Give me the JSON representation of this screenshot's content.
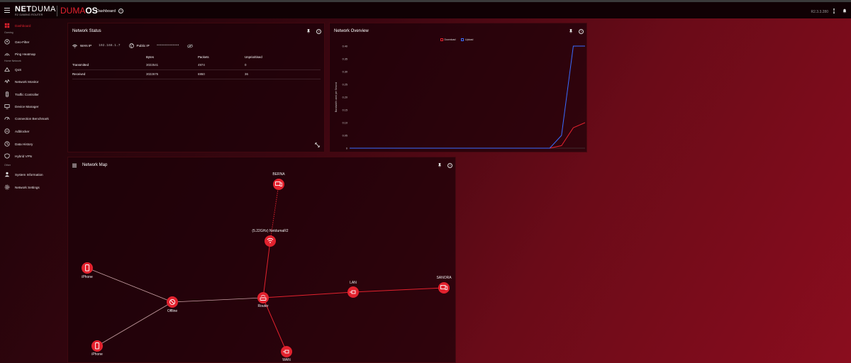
{
  "topbar": {
    "logo_net": "NET",
    "logo_duma": "DUMA",
    "logo_sub": "R2 GAMING ROUTER",
    "logo_os_duma": "DUMA",
    "logo_os": "OS",
    "breadcrumb": "Dashboard",
    "version": "R2.3.3.280"
  },
  "sidebar": {
    "items": [
      {
        "label": "Dashboard",
        "icon": "dashboard-icon",
        "active": true
      },
      {
        "section": "Gaming"
      },
      {
        "label": "Geo-Filter",
        "icon": "geo-filter-icon"
      },
      {
        "label": "Ping Heatmap",
        "icon": "ping-heatmap-icon"
      },
      {
        "section": "Home Network"
      },
      {
        "label": "QoS",
        "icon": "qos-icon"
      },
      {
        "label": "Network Monitor",
        "icon": "network-monitor-icon"
      },
      {
        "label": "Traffic Controller",
        "icon": "traffic-controller-icon"
      },
      {
        "label": "Device Manager",
        "icon": "device-manager-icon"
      },
      {
        "label": "Connection Benchmark",
        "icon": "benchmark-icon"
      },
      {
        "label": "Adblocker",
        "icon": "adblocker-icon"
      },
      {
        "label": "Data History",
        "icon": "data-history-icon"
      },
      {
        "label": "Hybrid VPN",
        "icon": "vpn-icon"
      },
      {
        "section": "Other"
      },
      {
        "label": "System Information",
        "icon": "system-info-icon"
      },
      {
        "label": "Network Settings",
        "icon": "settings-icon"
      }
    ]
  },
  "network_status": {
    "title": "Network Status",
    "wan_ip_label": "WAN IP",
    "wan_ip_value": "192.168.1.7",
    "public_ip_label": "Public IP",
    "public_ip_value": "••••••••••••••",
    "columns": [
      "",
      "Bytes",
      "Packets",
      "Unprioritised"
    ],
    "rows": [
      [
        "Transmitted",
        "3022541",
        "4974",
        "0"
      ],
      [
        "Received",
        "3022675",
        "6950",
        "36"
      ]
    ]
  },
  "network_overview": {
    "title": "Network Overview",
    "legend": [
      {
        "name": "Download",
        "color": "#e2222e"
      },
      {
        "name": "Upload",
        "color": "#3a6bff"
      }
    ],
    "ylabel": "Bandwidth used per Second"
  },
  "chart_data": {
    "type": "line",
    "ylabel": "Bandwidth used per Second",
    "ylim": [
      0,
      0.4
    ],
    "yticks": [
      "0",
      "0.05",
      "0.10",
      "0.15",
      "0.20",
      "0.25",
      "0.30",
      "0.35",
      "0.40"
    ],
    "x": [
      0,
      1,
      2,
      3,
      4,
      5,
      6,
      7,
      8,
      9,
      10,
      11,
      12,
      13,
      14,
      15,
      16,
      17,
      18,
      19,
      20
    ],
    "series": [
      {
        "name": "Download",
        "color": "#e2222e",
        "values": [
          0,
          0,
          0,
          0,
          0,
          0,
          0,
          0,
          0,
          0,
          0,
          0,
          0,
          0,
          0,
          0,
          0,
          0,
          0.01,
          0.08,
          0.1
        ]
      },
      {
        "name": "Upload",
        "color": "#3a6bff",
        "values": [
          0,
          0,
          0,
          0,
          0,
          0,
          0,
          0,
          0,
          0,
          0,
          0,
          0,
          0,
          0,
          0,
          0,
          0,
          0.05,
          0.4,
          0.4
        ]
      }
    ],
    "grid": false
  },
  "network_map": {
    "title": "Network Map",
    "nodes": [
      {
        "id": "berna",
        "label": "BERNA",
        "icon": "device-icon"
      },
      {
        "id": "wifi",
        "label": "(5.22GHz) NetdumaR2",
        "icon": "wifi-icon"
      },
      {
        "id": "iphone1",
        "label": "iPhone",
        "icon": "phone-icon"
      },
      {
        "id": "offline",
        "label": "Offline",
        "icon": "offline-icon"
      },
      {
        "id": "router",
        "label": "Router",
        "icon": "router-icon"
      },
      {
        "id": "lan",
        "label": "LAN",
        "icon": "ethernet-icon"
      },
      {
        "id": "sanora",
        "label": "SANORA",
        "icon": "device-icon"
      },
      {
        "id": "iphone2",
        "label": "iPhone",
        "icon": "phone-icon"
      },
      {
        "id": "wan",
        "label": "WAN",
        "icon": "ethernet-icon"
      }
    ]
  }
}
